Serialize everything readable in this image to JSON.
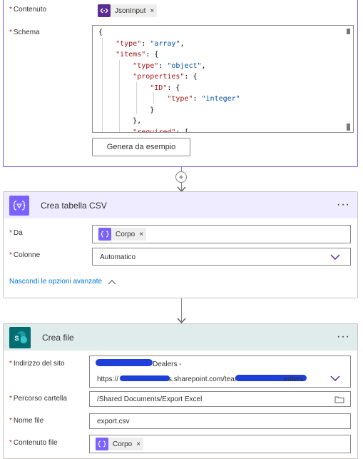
{
  "parse_json": {
    "content_label": "Contenuto",
    "content_token": "JsonInput",
    "schema_label": "Schema",
    "schema_lines": [
      "{",
      "    \"type\": \"array\",",
      "    \"items\": {",
      "        \"type\": \"object\",",
      "        \"properties\": {",
      "            \"ID\": {",
      "                \"type\": \"integer\"",
      "            }",
      "        },",
      "        \"required\": ["
    ],
    "generate_button": "Genera da esempio"
  },
  "connector1": {
    "plus_label": "+"
  },
  "csv_card": {
    "title": "Crea tabella CSV",
    "more": "···",
    "from_label": "Da",
    "from_token": "Corpo",
    "columns_label": "Colonne",
    "columns_value": "Automatico",
    "advanced_link": "Nascondi le opzioni avanzate",
    "accent_color": "#7b61ff"
  },
  "file_card": {
    "title": "Crea file",
    "more": "···",
    "site_label": "Indirizzo del sito",
    "site_line1": "Dealers -",
    "site_line2_prefix": "https://",
    "site_line2_mid": "s.sharepoint.com/teams/",
    "site_line2_suffix": "ealers",
    "folder_label": "Percorso cartella",
    "folder_value": "/Shared Documents/Export Excel",
    "filename_label": "Nome file",
    "filename_value": "export.csv",
    "content_label": "Contenuto file",
    "content_token": "Corpo",
    "accent_color": "#036c70"
  },
  "required_mark": "*",
  "token_close": "×"
}
